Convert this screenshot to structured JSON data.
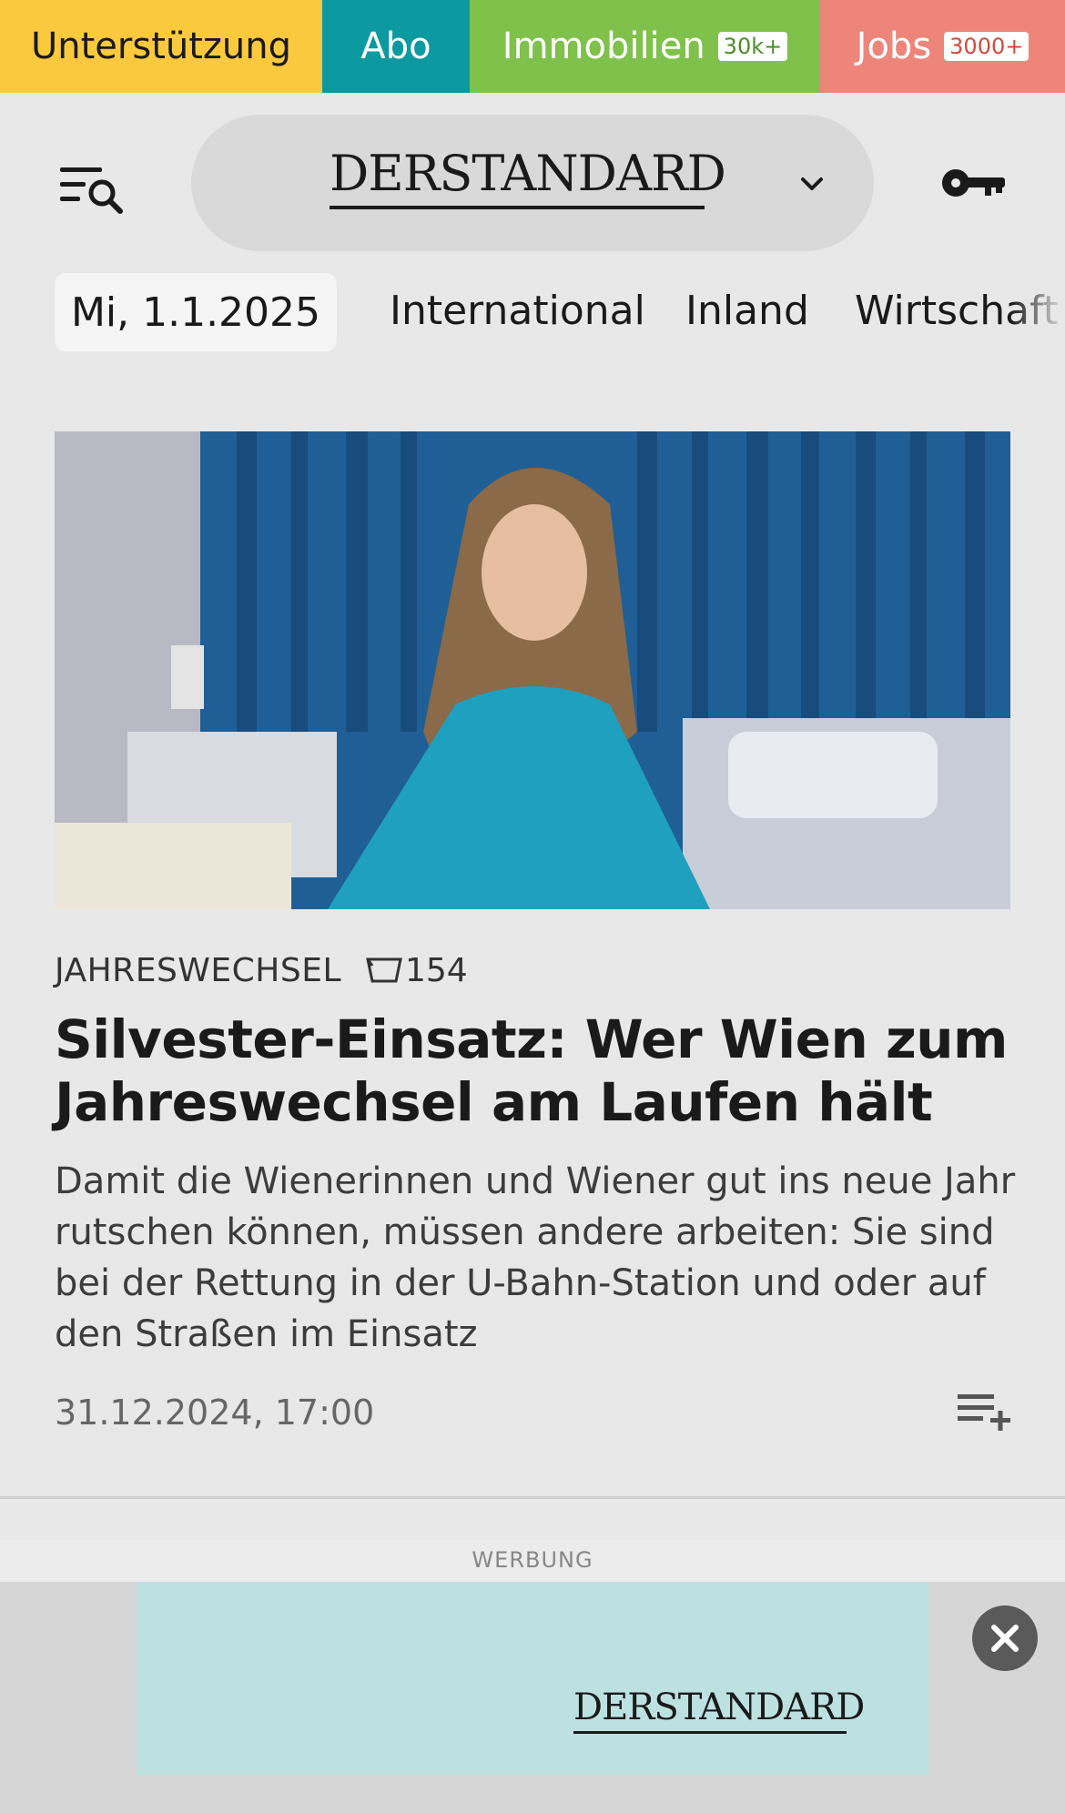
{
  "topbar": {
    "support_label": "Unterstützung",
    "abo_label": "Abo",
    "immobilien_label": "Immobilien",
    "immobilien_badge": "30k+",
    "jobs_label": "Jobs",
    "jobs_badge": "3000+"
  },
  "header": {
    "logo_text": "DERSTANDARD",
    "icons": [
      "menu-search-icon",
      "chevron-down-icon",
      "key-icon"
    ]
  },
  "nav": {
    "date": "Mi, 1.1.2025",
    "categories": [
      "International",
      "Inland",
      "Wirtschaft"
    ]
  },
  "article": {
    "kicker": "JAHRESWECHSEL",
    "comment_count": "154",
    "headline": "Silvester-Einsatz: Wer Wien zum Jahreswechsel am Laufen hält",
    "teaser": "Damit die Wienerinnen und Wiener gut ins neue Jahr rutschen können, müssen andere arbeiten: Sie sind bei der Rettung in der U-Bahn-Station und oder auf den Straßen im Einsatz",
    "timestamp": "31.12.2024, 17:00"
  },
  "ad": {
    "label": "WERBUNG",
    "logo_text": "DERSTANDARD"
  },
  "colors": {
    "support": "#fbc93d",
    "abo": "#0c9aa0",
    "immobilien": "#7fc14a",
    "jobs": "#ed857b",
    "ad_banner": "#bde1e1"
  }
}
